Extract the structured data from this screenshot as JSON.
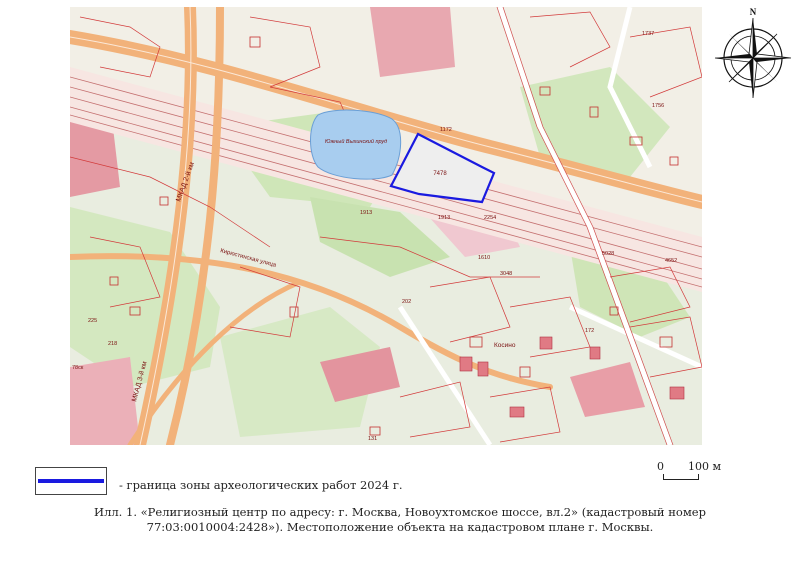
{
  "map": {
    "labels": {
      "pond_name": "Южный Выхинский пруд",
      "parcel_number": "7478",
      "road_mkad": "МКАД 2-й км",
      "road_mkad_lower": "МКАД 3-й км",
      "street": "Кирюстинская улица",
      "station": "Косино",
      "parcel_a": "1913",
      "parcel_b": "1913",
      "parcel_c": "2254",
      "parcel_d": "3048",
      "parcel_e": "1610",
      "parcel_f": "202",
      "parcel_g": "225",
      "parcel_h": "1172",
      "parcel_i": "5028",
      "parcel_j": "4652",
      "parcel_k": "131",
      "parcel_l": "218",
      "parcel_m": "78ск",
      "parcel_n": "172",
      "parcel_o": "1737",
      "parcel_p": "1756"
    }
  },
  "compass": {
    "north_label": "N"
  },
  "legend": {
    "text": "- граница зоны археологических работ 2024 г.",
    "line_color": "#1a1ae0"
  },
  "scalebar": {
    "zero": "0",
    "length": "100 м"
  },
  "caption": {
    "line1": "Илл. 1. «Религиозный центр по адресу: г. Москва, Новоухтомское шоссе, вл.2» (кадастровый номер",
    "line2": "77:03:0010004:2428»). Местоположение объекта на кадастровом плане г. Москвы."
  }
}
